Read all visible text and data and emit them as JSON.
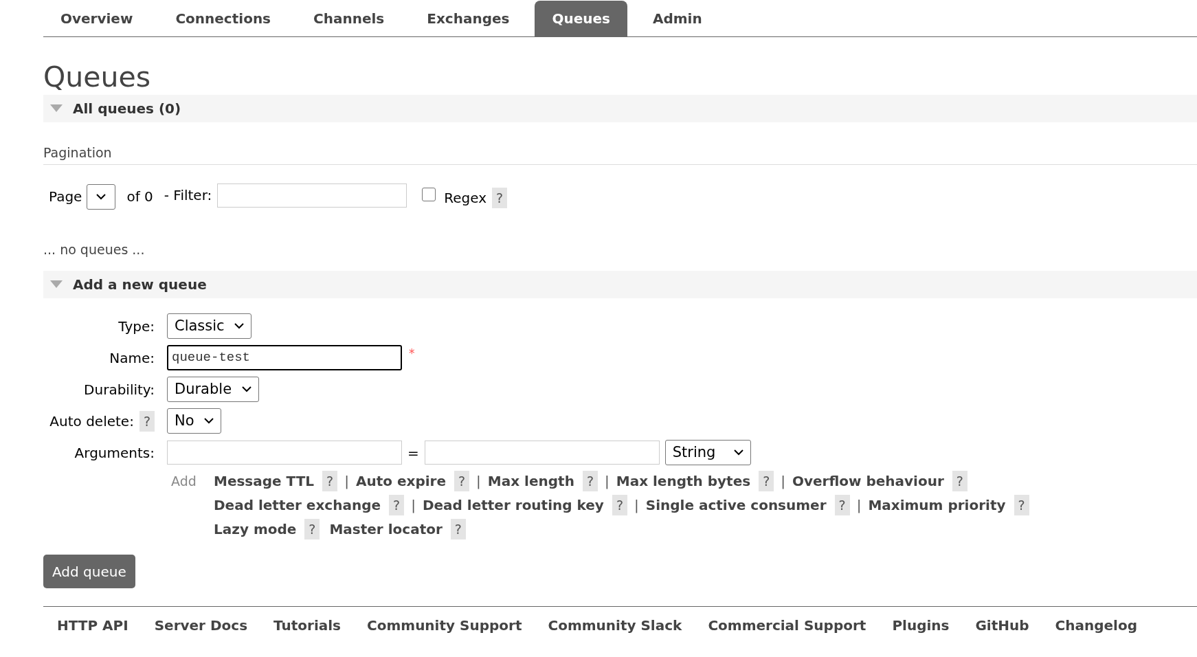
{
  "tabs": [
    {
      "label": "Overview",
      "selected": false
    },
    {
      "label": "Connections",
      "selected": false
    },
    {
      "label": "Channels",
      "selected": false
    },
    {
      "label": "Exchanges",
      "selected": false
    },
    {
      "label": "Queues",
      "selected": true
    },
    {
      "label": "Admin",
      "selected": false
    }
  ],
  "title": "Queues",
  "all_queues": {
    "heading": "All queues (0)",
    "expanded": true,
    "pagination": {
      "heading": "Pagination",
      "page_label": "Page",
      "of_label": "of 0",
      "filter_label": "- Filter:",
      "regex_label": "Regex",
      "regex_checked": false,
      "help": "?"
    },
    "empty_message": "... no queues ..."
  },
  "add_queue": {
    "heading": "Add a new queue",
    "expanded": true,
    "type": {
      "label": "Type:",
      "value": "Classic"
    },
    "name": {
      "label": "Name:",
      "value": "queue-test",
      "required_mark": "*"
    },
    "durability": {
      "label": "Durability:",
      "value": "Durable"
    },
    "auto_delete": {
      "label": "Auto delete:",
      "help": "?",
      "value": "No"
    },
    "arguments": {
      "label": "Arguments:",
      "equals": "=",
      "value_type": "String",
      "add_label": "Add",
      "lines": [
        [
          {
            "label": "Message TTL",
            "help": "?",
            "separator": "|"
          },
          {
            "label": "Auto expire",
            "help": "?",
            "separator": "|"
          },
          {
            "label": "Max length",
            "help": "?",
            "separator": "|"
          },
          {
            "label": "Max length bytes",
            "help": "?",
            "separator": "|"
          },
          {
            "label": "Overflow behaviour",
            "help": "?"
          }
        ],
        [
          {
            "label": "Dead letter exchange",
            "help": "?",
            "separator": "|"
          },
          {
            "label": "Dead letter routing key",
            "help": "?",
            "separator": "|"
          },
          {
            "label": "Single active consumer",
            "help": "?",
            "separator": "|"
          },
          {
            "label": "Maximum priority",
            "help": "?"
          }
        ],
        [
          {
            "label": "Lazy mode",
            "help": "?"
          },
          {
            "label": "Master locator",
            "help": "?"
          }
        ]
      ]
    },
    "submit": "Add queue"
  },
  "footer": [
    "HTTP API",
    "Server Docs",
    "Tutorials",
    "Community Support",
    "Community Slack",
    "Commercial Support",
    "Plugins",
    "GitHub",
    "Changelog"
  ]
}
